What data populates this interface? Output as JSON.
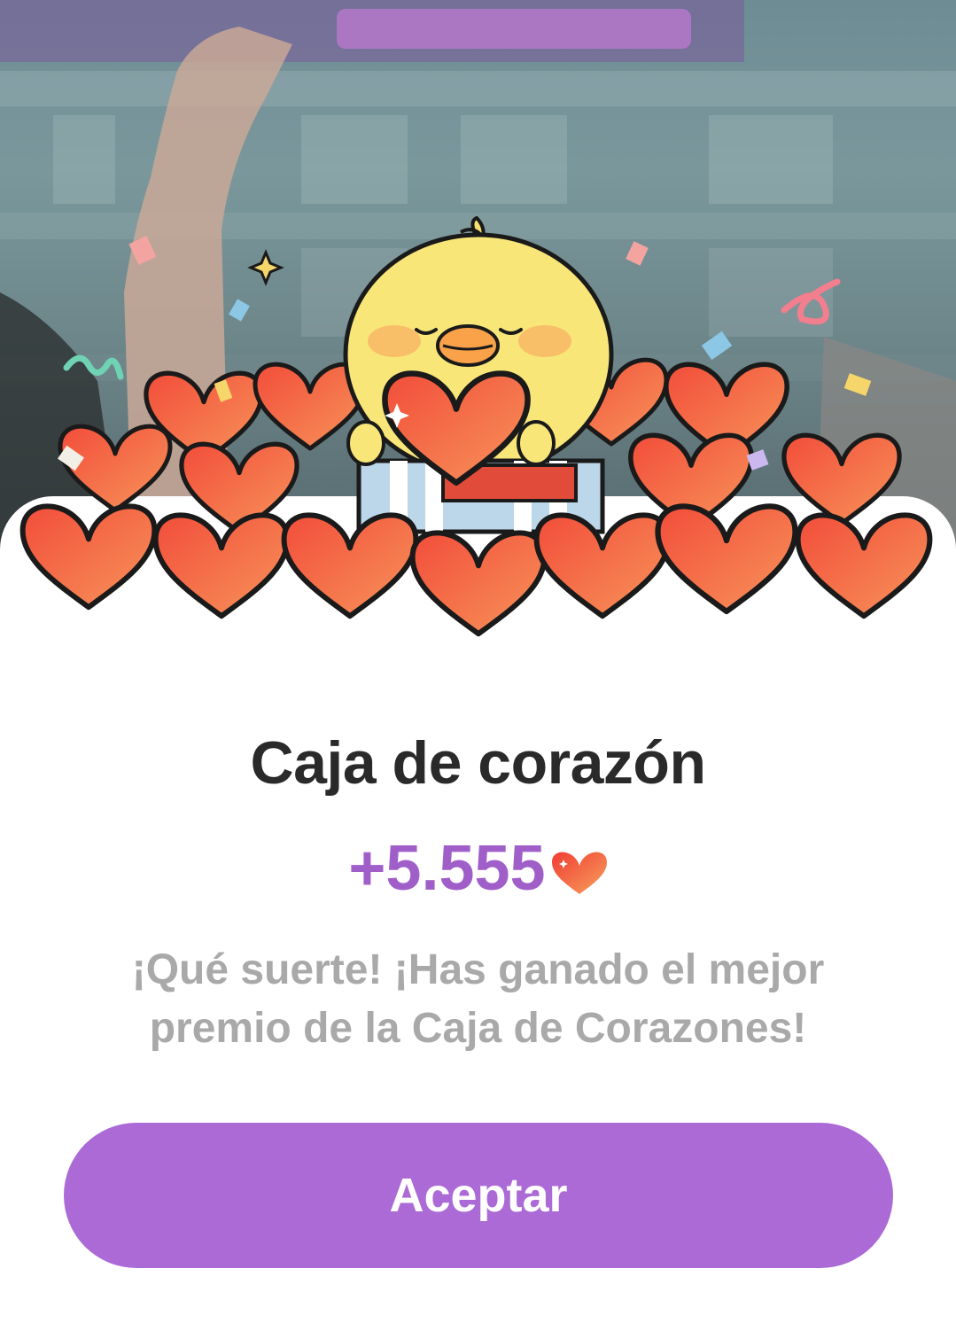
{
  "modal": {
    "title": "Caja de corazón",
    "reward_amount": "+5.555",
    "message": "¡Qué suerte! ¡Has ganado el mejor premio de la Caja de Corazones!",
    "accept_label": "Aceptar"
  },
  "colors": {
    "accent": "#ab6ad6",
    "reward_text": "#a05ec9",
    "title_text": "#2a2a2a",
    "message_text": "#a9a9a9",
    "heart": "#f25a3c"
  },
  "icons": {
    "reward_icon": "heart-icon",
    "illustration": "chick-with-hearts-illustration"
  }
}
